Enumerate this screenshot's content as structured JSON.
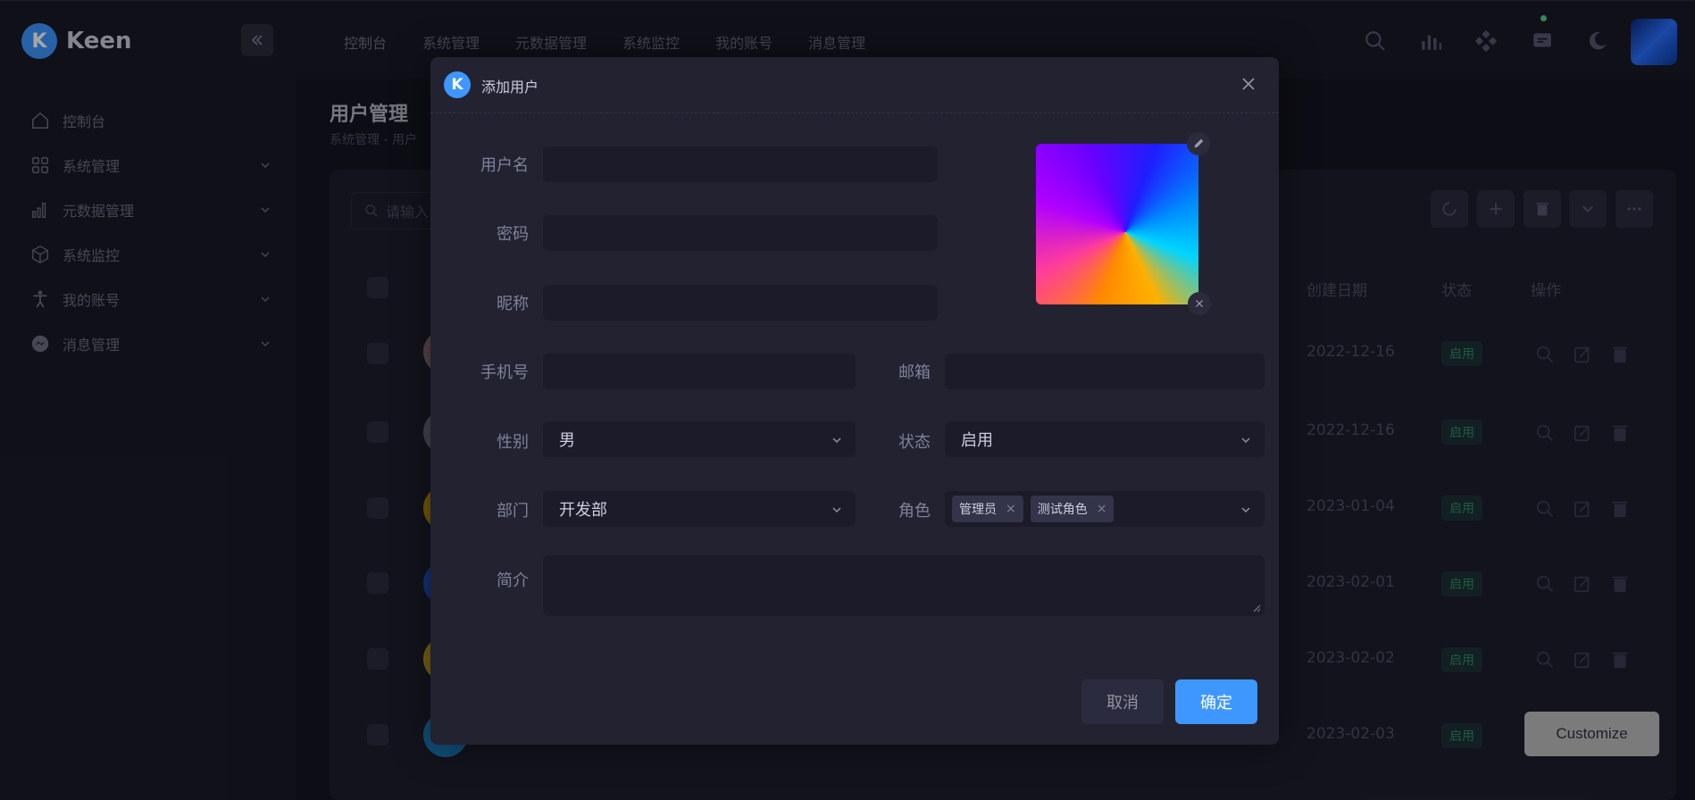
{
  "app": {
    "brand": "Keen"
  },
  "topnav": [
    "控制台",
    "系统管理",
    "元数据管理",
    "系统监控",
    "我的账号",
    "消息管理"
  ],
  "sidebar": {
    "items": [
      {
        "label": "控制台",
        "icon": "home-icon"
      },
      {
        "label": "系统管理",
        "icon": "grid-icon"
      },
      {
        "label": "元数据管理",
        "icon": "chart-icon"
      },
      {
        "label": "系统监控",
        "icon": "cube-icon"
      },
      {
        "label": "我的账号",
        "icon": "person-icon"
      },
      {
        "label": "消息管理",
        "icon": "messenger-icon"
      }
    ]
  },
  "page": {
    "title": "用户管理",
    "breadcrumb": "系统管理 - 用户"
  },
  "table": {
    "search_placeholder": "请输入",
    "headers": {
      "created": "创建日期",
      "status": "状态",
      "actions": "操作"
    },
    "rows": [
      {
        "created": "2022-12-16",
        "status": "启用"
      },
      {
        "created": "2022-12-16",
        "status": "启用"
      },
      {
        "created": "2023-01-04",
        "status": "启用"
      },
      {
        "created": "2023-02-01",
        "status": "启用"
      },
      {
        "created": "2023-02-02",
        "status": "启用"
      },
      {
        "created": "2023-02-03",
        "status": "启用"
      }
    ]
  },
  "modal": {
    "title": "添加用户",
    "labels": {
      "username": "用户名",
      "password": "密码",
      "nickname": "昵称",
      "phone": "手机号",
      "email": "邮箱",
      "gender": "性别",
      "status": "状态",
      "department": "部门",
      "role": "角色",
      "bio": "简介"
    },
    "values": {
      "gender": "男",
      "status": "启用",
      "department": "开发部",
      "roles": [
        "管理员",
        "测试角色"
      ]
    },
    "buttons": {
      "cancel": "取消",
      "ok": "确定"
    }
  },
  "customize": "Customize",
  "colors": {
    "primary": "#3e97ff",
    "success": "#50cd89",
    "bg": "#1e1e2d"
  }
}
